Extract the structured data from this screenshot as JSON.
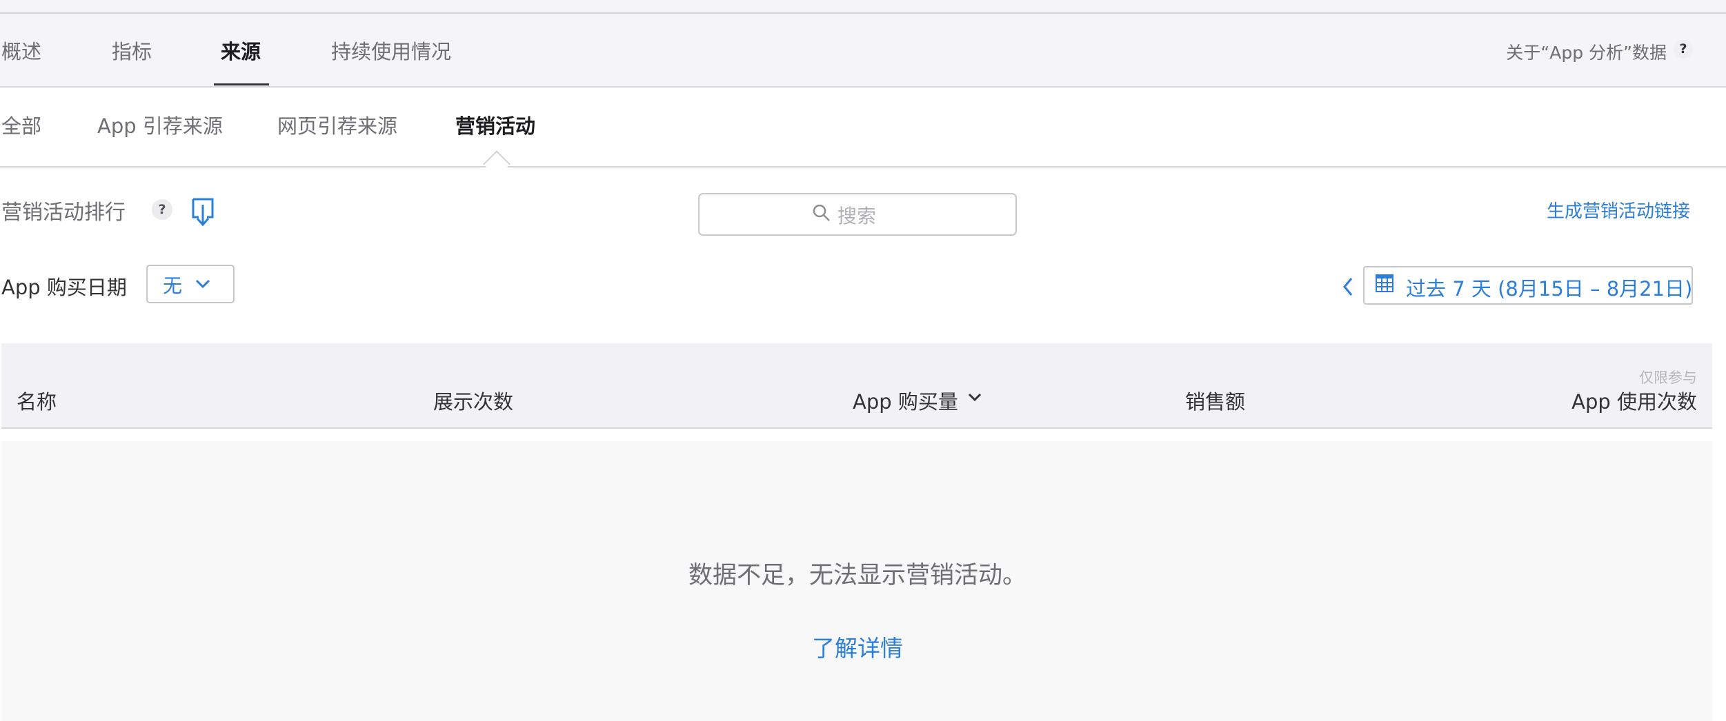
{
  "primary_tabs": [
    {
      "label": "概述",
      "active": false
    },
    {
      "label": "指标",
      "active": false
    },
    {
      "label": "来源",
      "active": true
    },
    {
      "label": "持续使用情况",
      "active": false
    }
  ],
  "about_link": "关于“App 分析”数据",
  "help_mark": "?",
  "secondary_tabs": [
    {
      "label": "全部",
      "active": false
    },
    {
      "label": "App 引荐来源",
      "active": false
    },
    {
      "label": "网页引荐来源",
      "active": false
    },
    {
      "label": "营销活动",
      "active": true
    }
  ],
  "section": {
    "title": "营销活动排行",
    "help": "?"
  },
  "search": {
    "placeholder": "搜索"
  },
  "generate_link": "生成营销活动链接",
  "filter": {
    "label": "App 购买日期",
    "value": "无"
  },
  "date_range": "过去 7 天 (8月15日 – 8月21日)",
  "table": {
    "columns": [
      "名称",
      "展示次数",
      "App 购买量",
      "销售额",
      "App 使用次数"
    ],
    "last_column_note": "仅限参与",
    "sorted_column": "App 购买量"
  },
  "empty_state": {
    "message": "数据不足，无法显示营销活动。",
    "link": "了解详情"
  },
  "colors": {
    "accent": "#2b7fd8",
    "text_primary": "#1d1d1f",
    "text_secondary": "#6e6e73",
    "tab_bar_bg": "#f5f5f7"
  }
}
